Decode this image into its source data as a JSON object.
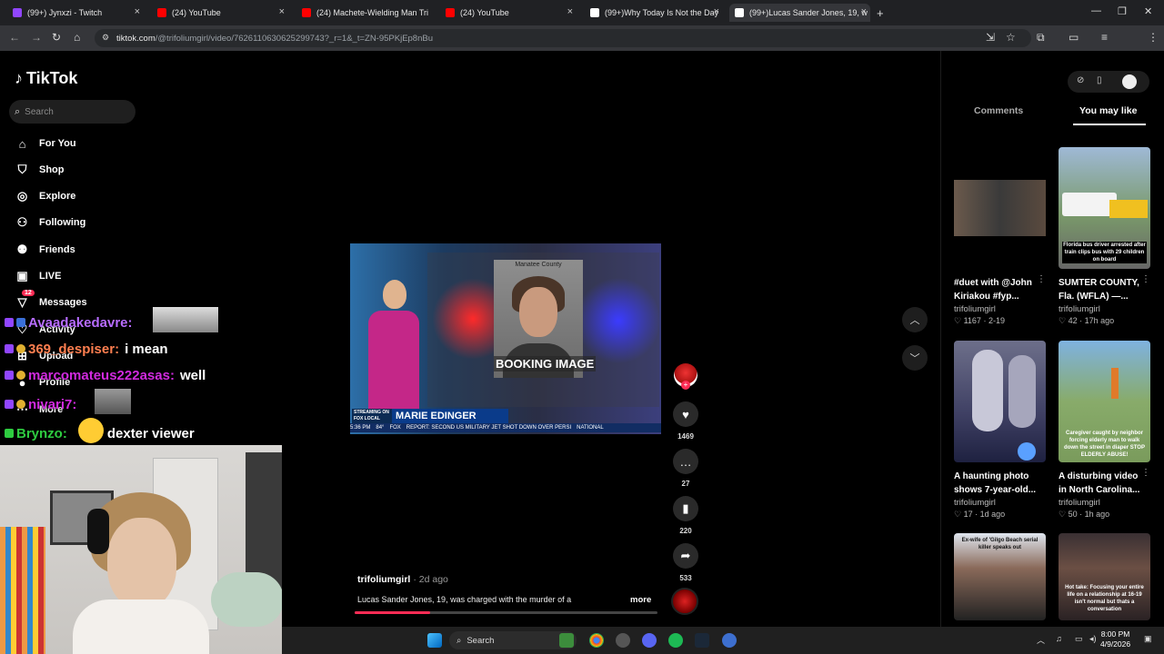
{
  "browser": {
    "tabs": [
      {
        "title": "(99+) Jynxzi - Twitch",
        "color": "#9146ff"
      },
      {
        "title": "(24) YouTube",
        "color": "#ff0000"
      },
      {
        "title": "(24) Machete-Wielding Man Tri",
        "color": "#ff0000"
      },
      {
        "title": "(24) YouTube",
        "color": "#ff0000"
      },
      {
        "title": "(99+)Why Today Is Not the Day",
        "color": "#ffffff"
      },
      {
        "title": "(99+)Lucas Sander Jones, 19, w",
        "color": "#ffffff"
      }
    ],
    "url_host": "tiktok.com",
    "url_path": "/@trifoliumgirl/video/7626110630625299743?_r=1&_t=ZN-95PKjEp8nBu"
  },
  "tiktok": {
    "logo": "TikTok",
    "search_placeholder": "Search",
    "nav": [
      {
        "label": "For You",
        "icon": "home-icon"
      },
      {
        "label": "Shop",
        "icon": "shop-icon"
      },
      {
        "label": "Explore",
        "icon": "compass-icon"
      },
      {
        "label": "Following",
        "icon": "following-icon"
      },
      {
        "label": "Friends",
        "icon": "friends-icon"
      },
      {
        "label": "LIVE",
        "icon": "live-icon"
      },
      {
        "label": "Messages",
        "icon": "messages-icon",
        "badge": "12"
      },
      {
        "label": "Activity",
        "icon": "activity-icon"
      },
      {
        "label": "Upload",
        "icon": "upload-icon"
      },
      {
        "label": "Profile",
        "icon": "profile-icon"
      },
      {
        "label": "More",
        "icon": "more-icon"
      }
    ],
    "video": {
      "mugshot_header": "Manatee County",
      "booking_text": "BOOKING IMAGE",
      "streaming_label": "STREAMING ON FOX LOCAL",
      "anchor_name": "MARIE EDINGER",
      "ticker_time": "5:36 PM",
      "ticker_temp": "84°",
      "ticker_network": "FOX",
      "ticker_text": "REPORT: SECOND US MILITARY JET SHOT DOWN OVER PERSI",
      "ticker_tag": "NATIONAL",
      "progress": 0.25
    },
    "actions": {
      "likes": "1469",
      "comments": "27",
      "saves": "220",
      "shares": "533"
    },
    "caption": {
      "username": "trifoliumgirl",
      "when": "· 2d ago",
      "text": "Lucas Sander Jones, 19, was charged with the murder of a",
      "more": "more"
    },
    "right_panel": {
      "tab_comments": "Comments",
      "tab_you_may_like": "You may like",
      "cards": [
        {
          "title1": "#duet with @John",
          "title2": "Kiriakou #fyp...",
          "user": "trifoliumgirl",
          "likes": "1167",
          "date": "2-19",
          "overlay": ""
        },
        {
          "title1": "SUMTER COUNTY,",
          "title2": "Fla. (WFLA) —...",
          "user": "trifoliumgirl",
          "likes": "42",
          "date": "17h ago",
          "overlay": "Florida bus driver arrested after train clips bus with 29 children on board"
        },
        {
          "title1": "A haunting photo",
          "title2": "shows 7-year-old...",
          "user": "trifoliumgirl",
          "likes": "17",
          "date": "1d ago",
          "overlay": ""
        },
        {
          "title1": "A disturbing video",
          "title2": "in North Carolina...",
          "user": "trifoliumgirl",
          "likes": "50",
          "date": "1h ago",
          "overlay": "Caregiver caught by neighbor forcing elderly man to walk down the street in diaper STOP ELDERLY ABUSE!"
        },
        {
          "title1": "",
          "title2": "",
          "user": "",
          "likes": "",
          "date": "",
          "overlay": "Ex-wife of 'Gilgo Beach serial killer speaks out"
        },
        {
          "title1": "",
          "title2": "",
          "user": "",
          "likes": "",
          "date": "",
          "overlay": "Hot take: Focusing your entire life on a relationship at 16-19 isn't normal but thats a conversation"
        }
      ]
    }
  },
  "chat": [
    {
      "user": "Avaadakedavre:",
      "color": "#b76cff",
      "msg": ""
    },
    {
      "user": "369_despiser:",
      "color": "#ff7f50",
      "msg": "i mean"
    },
    {
      "user": "marcomateus222asas:",
      "color": "#d12adf",
      "msg": "well"
    },
    {
      "user": "nivari7:",
      "color": "#d12adf",
      "msg": ""
    },
    {
      "user": "Brynzo:",
      "color": "#2ecc40",
      "msg": "dexter viewer"
    }
  ],
  "taskbar": {
    "search": "Search",
    "time": "8:00 PM",
    "date": "4/9/2026"
  }
}
